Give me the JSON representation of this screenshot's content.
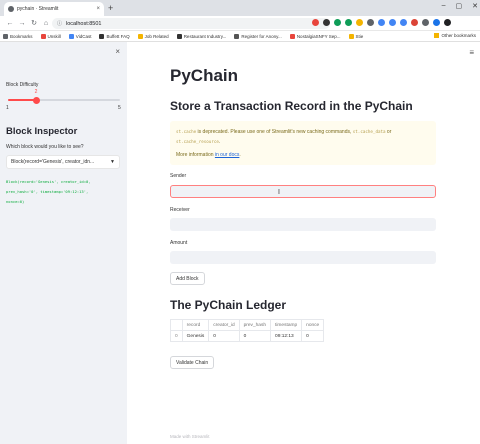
{
  "browser": {
    "tab_title": "pychain · Streamlit",
    "tab_close": "×",
    "new_tab": "+",
    "win_min": "–",
    "win_max": "▢",
    "win_close": "✕",
    "url": "localhost:8501",
    "bookmarks": [
      {
        "label": "Bookmarks",
        "color": "#5f6368"
      },
      {
        "label": "Unskill",
        "color": "#e8453c"
      },
      {
        "label": "VidCast",
        "color": "#4285f4"
      },
      {
        "label": "Buffett FAQ",
        "color": "#333333"
      },
      {
        "label": "Job Related",
        "color": "#f4b400"
      },
      {
        "label": "Restaurant Industry...",
        "color": "#333333"
      },
      {
        "label": "Register for Anony...",
        "color": "#555555"
      },
      {
        "label": "NostalgiaSNFY Sep...",
        "color": "#e8453c"
      },
      {
        "label": "Stie",
        "color": "#f4b400"
      }
    ],
    "other_bookmarks": "Other bookmarks",
    "ext_colors": [
      "#e8453c",
      "#333333",
      "#0f9d58",
      "#0f9d58",
      "#f4b400",
      "#5f6368",
      "#4285f4",
      "#4285f4",
      "#4285f4",
      "#db4437",
      "#5f6368",
      "#1a73e8",
      "#202124"
    ]
  },
  "sidebar": {
    "close": "×",
    "slider_label": "Block Difficulty",
    "slider_value": "2",
    "slider_min": "1",
    "slider_max": "5",
    "slider_fraction": 0.25,
    "heading": "Block Inspector",
    "select_label": "Which block would you like to see?",
    "select_value": "Block(record='Genesis', creator_idn...",
    "code": "Block(record='Genesis', creator_id=0,\nprev_hash='0', timestamp='09:12:13',\nnonce=0)"
  },
  "main": {
    "menu": "≡",
    "title": "PyChain",
    "store_heading": "Store a Transaction Record in the PyChain",
    "warning": {
      "code1": "st.cache",
      "text1": " is deprecated. Please use one of Streamlit's new caching commands, ",
      "code2": "st.cache_data",
      "text2": " or ",
      "code3": "st.cache_resource",
      "text3": ".",
      "more": "More information ",
      "link": "in our docs",
      "end": "."
    },
    "sender_label": "Sender",
    "sender_value": "",
    "receiver_label": "Receiver",
    "receiver_value": "",
    "amount_label": "Amount",
    "amount_value": "",
    "add_block": "Add Block",
    "ledger_heading": "The PyChain Ledger",
    "ledger_columns": [
      "",
      "record",
      "creator_id",
      "prev_hash",
      "timestamp",
      "nonce"
    ],
    "ledger_rows": [
      [
        "0",
        "Genesis",
        "0",
        "0",
        "09:12:13",
        "0"
      ]
    ],
    "validate": "Validate Chain",
    "footer": "Made with Streamlit"
  }
}
